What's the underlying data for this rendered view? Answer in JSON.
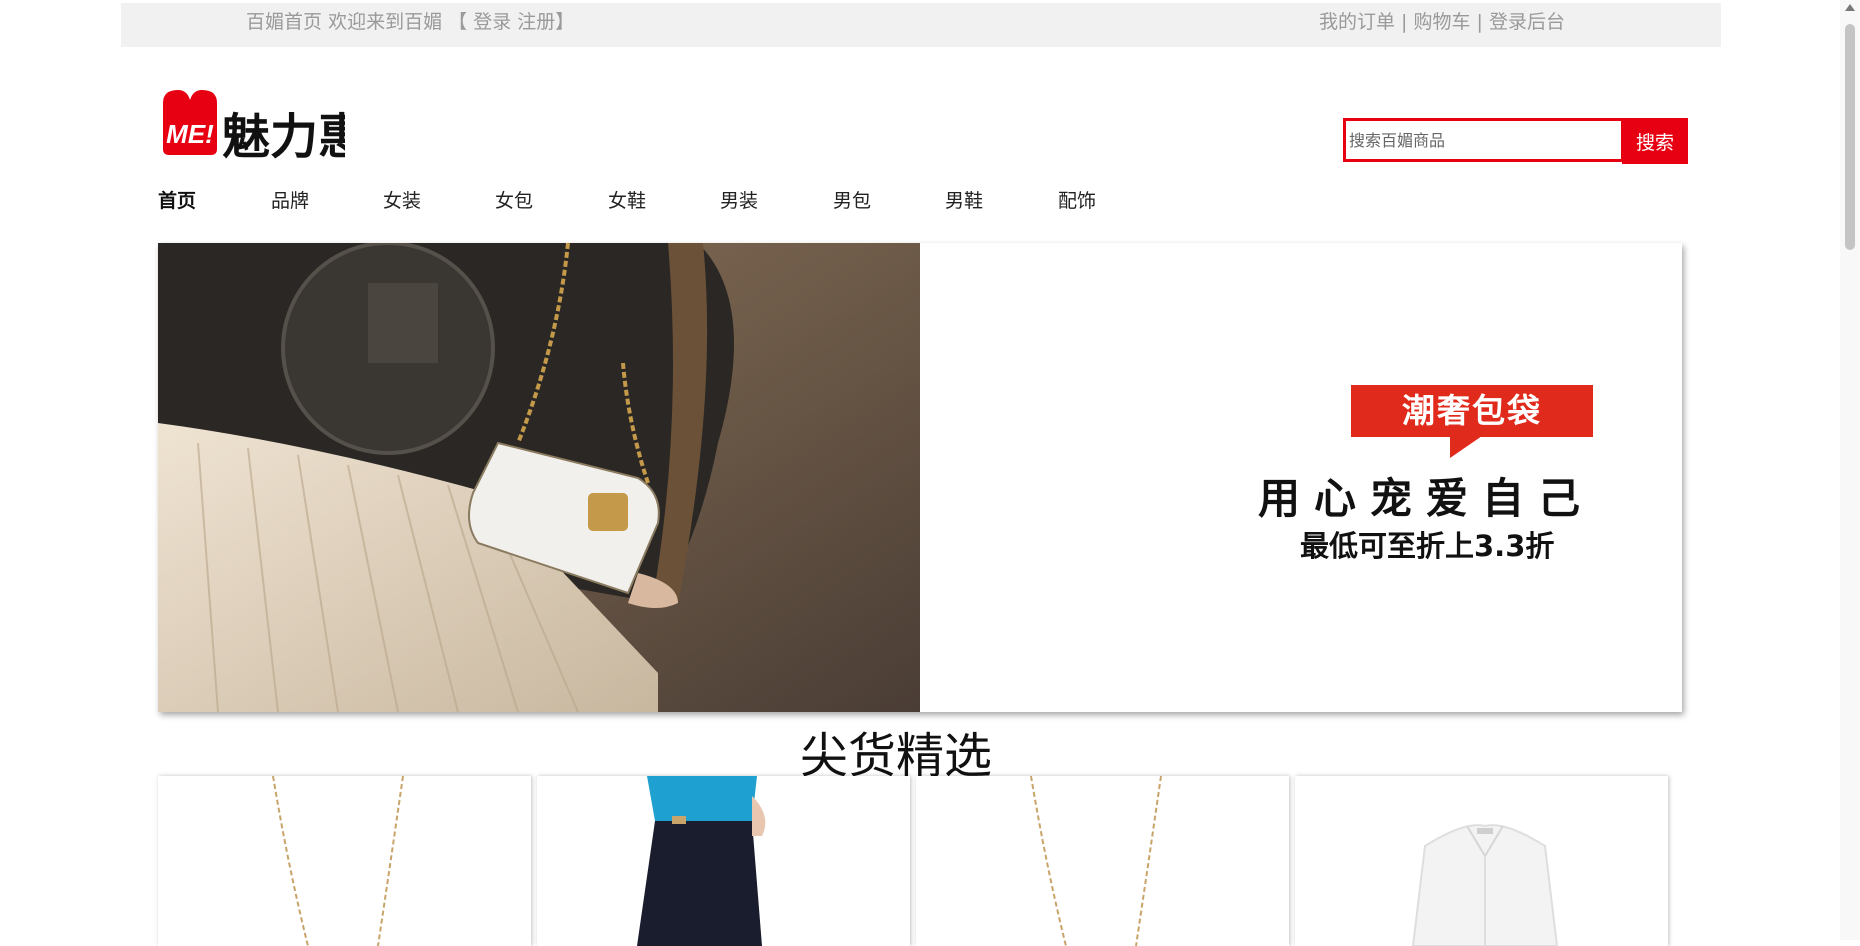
{
  "topbar": {
    "home": "百媚首页",
    "welcome": "欢迎来到百媚",
    "bracket_open": "【",
    "login": "登录",
    "register": "注册",
    "bracket_close": "】",
    "my_orders": "我的订单",
    "cart": "购物车",
    "admin_login": "登录后台",
    "separator": "|"
  },
  "header": {
    "logo_badge": "ME!",
    "logo_text": "魅力惠",
    "search_placeholder": "搜索百媚商品",
    "search_button": "搜索"
  },
  "nav": {
    "items": [
      "首页",
      "品牌",
      "女装",
      "女包",
      "女鞋",
      "男装",
      "男包",
      "男鞋",
      "配饰"
    ],
    "active_index": 0
  },
  "banner": {
    "tag": "潮奢包袋",
    "headline": "用心宠爱自己",
    "subline": "最低可至折上3.3折"
  },
  "section": {
    "title": "尖货精选"
  },
  "products": [
    {
      "image": "gold-necklace"
    },
    {
      "image": "blue-top-black-skirt"
    },
    {
      "image": "gold-necklace"
    },
    {
      "image": "white-shirt"
    }
  ],
  "colors": {
    "accent": "#e60012",
    "topbar_bg": "#f1f1f1",
    "topbar_text": "#9a9a9a",
    "tag_red": "#e02a1b"
  }
}
